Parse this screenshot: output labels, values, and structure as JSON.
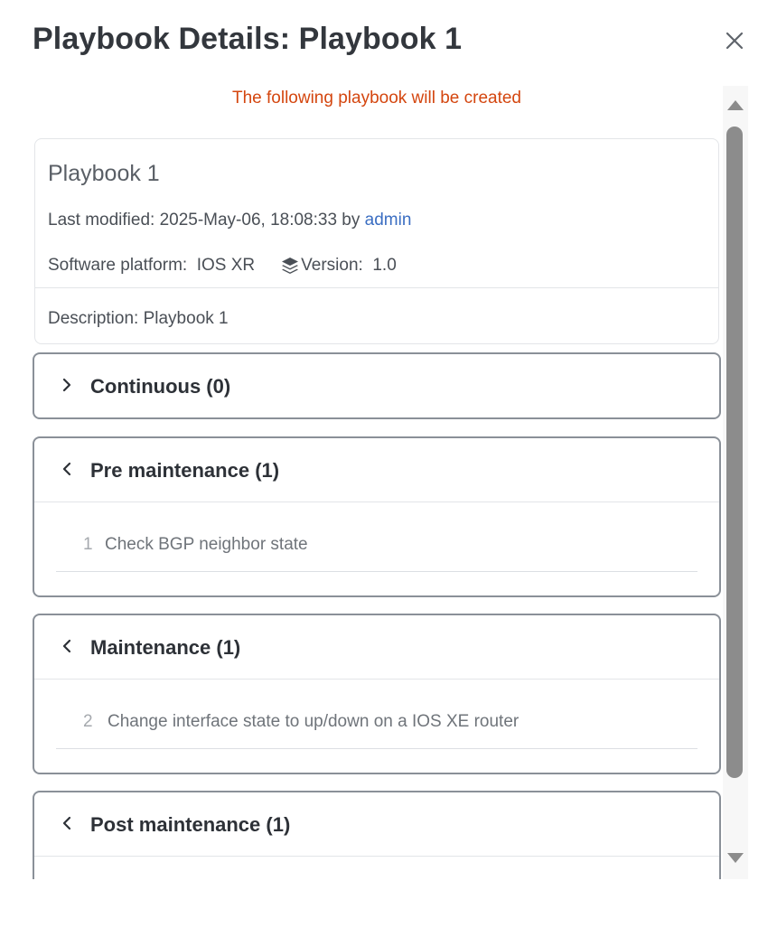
{
  "modal": {
    "title": "Playbook Details: Playbook 1",
    "close_icon": "close-icon"
  },
  "notice": "The following playbook will be created",
  "playbook": {
    "name": "Playbook 1",
    "modified_prefix": "Last modified: 2025-May-06, 18:08:33 by ",
    "modified_by": "admin",
    "platform_label": "Software platform:",
    "platform_value": "IOS XR",
    "version_icon": "layers-icon",
    "version_label": "Version:",
    "version_value": "1.0",
    "description": "Description: Playbook 1"
  },
  "sections": [
    {
      "title": "Continuous (0)",
      "expanded": false,
      "chevron": "chevron-right-icon",
      "tasks": []
    },
    {
      "title": "Pre maintenance (1)",
      "expanded": true,
      "chevron": "chevron-left-icon",
      "tasks": [
        {
          "num": "1",
          "name": "Check BGP neighbor state"
        }
      ]
    },
    {
      "title": "Maintenance (1)",
      "expanded": true,
      "chevron": "chevron-left-icon",
      "tasks": [
        {
          "num": "2",
          "name": "Change interface state to up/down on a IOS XE router"
        }
      ]
    },
    {
      "title": "Post maintenance (1)",
      "expanded": true,
      "chevron": "chevron-left-icon",
      "tasks": []
    }
  ],
  "colors": {
    "notice": "#d4460f",
    "link": "#3b6ec2",
    "section_border": "#8a9098",
    "scroll_thumb": "#8c8c8c"
  }
}
